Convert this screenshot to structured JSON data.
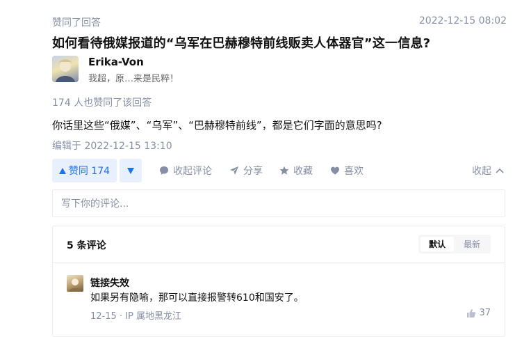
{
  "activity": {
    "label": "赞同了回答",
    "timestamp": "2022-12-15 08:02"
  },
  "question": {
    "title": "如何看待俄媒报道的“乌军在巴赫穆特前线贩卖人体器官”这一信息?"
  },
  "author": {
    "name": "Erika-Von",
    "bio": "我超，原…来是民粹！"
  },
  "answer": {
    "also_voted": "174 人也赞同了该回答",
    "content": "你话里这些“俄媒”、“乌军”、“巴赫穆特前线”，都是它们字面的意思吗?",
    "edited": "编辑于 2022-12-15 13:10"
  },
  "actions": {
    "upvote_label": "赞同 174",
    "collapse_comments": "收起评论",
    "share": "分享",
    "favorite": "收藏",
    "like": "喜欢",
    "collapse": "收起"
  },
  "comment_input": {
    "placeholder": "写下你的评论..."
  },
  "comments": {
    "count_label": "5 条评论",
    "sort_default": "默认",
    "sort_latest": "最新",
    "items": [
      {
        "author": "链接失效",
        "text": "如果另有隐喻，那可以直接报警转610和国安了。",
        "meta": "12-15 · IP 属地黑龙江",
        "likes": "37"
      }
    ]
  },
  "colors": {
    "accent": "#1772f6",
    "accent_bg": "#e8f0fd",
    "muted": "#8590a6"
  }
}
